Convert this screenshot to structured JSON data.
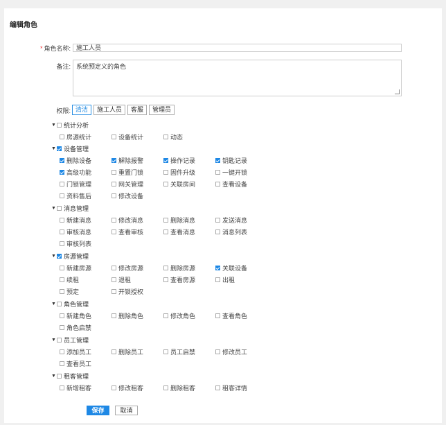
{
  "page": {
    "title": "编辑角色"
  },
  "form": {
    "role_name_label": "角色名称:",
    "role_name_value": "施工人员",
    "remark_label": "备注:",
    "remark_value": "系统预定义的角色",
    "permission_label": "权限:"
  },
  "tabs": [
    "清洁",
    "施工人员",
    "客服",
    "管理员"
  ],
  "groups": [
    {
      "label": "统计分析",
      "checked": false,
      "items": [
        {
          "label": "房源统计",
          "checked": false
        },
        {
          "label": "设备统计",
          "checked": false
        },
        {
          "label": "动态",
          "checked": false
        }
      ]
    },
    {
      "label": "设备管理",
      "checked": true,
      "items": [
        {
          "label": "删除设备",
          "checked": true
        },
        {
          "label": "解除报警",
          "checked": true
        },
        {
          "label": "操作记录",
          "checked": true
        },
        {
          "label": "钥匙记录",
          "checked": true
        },
        {
          "label": "高级功能",
          "checked": true
        },
        {
          "label": "重置门锁",
          "checked": false
        },
        {
          "label": "固件升级",
          "checked": false
        },
        {
          "label": "一键开锁",
          "checked": false
        },
        {
          "label": "门锁管理",
          "checked": false
        },
        {
          "label": "网关管理",
          "checked": false
        },
        {
          "label": "关联房间",
          "checked": false
        },
        {
          "label": "查看设备",
          "checked": false
        },
        {
          "label": "资料售后",
          "checked": false
        },
        {
          "label": "修改设备",
          "checked": false
        }
      ]
    },
    {
      "label": "消息管理",
      "checked": false,
      "items": [
        {
          "label": "新建消息",
          "checked": false
        },
        {
          "label": "修改消息",
          "checked": false
        },
        {
          "label": "删除消息",
          "checked": false
        },
        {
          "label": "发送消息",
          "checked": false
        },
        {
          "label": "审核消息",
          "checked": false
        },
        {
          "label": "查看审核",
          "checked": false
        },
        {
          "label": "查看消息",
          "checked": false
        },
        {
          "label": "消息列表",
          "checked": false
        },
        {
          "label": "审核列表",
          "checked": false
        }
      ]
    },
    {
      "label": "房源管理",
      "checked": true,
      "items": [
        {
          "label": "新建房源",
          "checked": false
        },
        {
          "label": "修改房源",
          "checked": false
        },
        {
          "label": "删除房源",
          "checked": false
        },
        {
          "label": "关联设备",
          "checked": true
        },
        {
          "label": "续租",
          "checked": false
        },
        {
          "label": "退租",
          "checked": false
        },
        {
          "label": "查看房源",
          "checked": false
        },
        {
          "label": "出租",
          "checked": false
        },
        {
          "label": "预定",
          "checked": false
        },
        {
          "label": "开锁授权",
          "checked": false
        }
      ]
    },
    {
      "label": "角色管理",
      "checked": false,
      "items": [
        {
          "label": "新建角色",
          "checked": false
        },
        {
          "label": "删除角色",
          "checked": false
        },
        {
          "label": "修改角色",
          "checked": false
        },
        {
          "label": "查看角色",
          "checked": false
        },
        {
          "label": "角色启禁",
          "checked": false
        }
      ]
    },
    {
      "label": "员工管理",
      "checked": false,
      "items": [
        {
          "label": "添加员工",
          "checked": false
        },
        {
          "label": "删除员工",
          "checked": false
        },
        {
          "label": "员工启禁",
          "checked": false
        },
        {
          "label": "修改员工",
          "checked": false
        },
        {
          "label": "查看员工",
          "checked": false
        }
      ]
    },
    {
      "label": "租客管理",
      "checked": false,
      "items": [
        {
          "label": "新增租客",
          "checked": false
        },
        {
          "label": "修改租客",
          "checked": false
        },
        {
          "label": "删除租客",
          "checked": false
        },
        {
          "label": "租客详情",
          "checked": false
        }
      ]
    }
  ],
  "buttons": {
    "save": "保存",
    "cancel": "取消"
  }
}
